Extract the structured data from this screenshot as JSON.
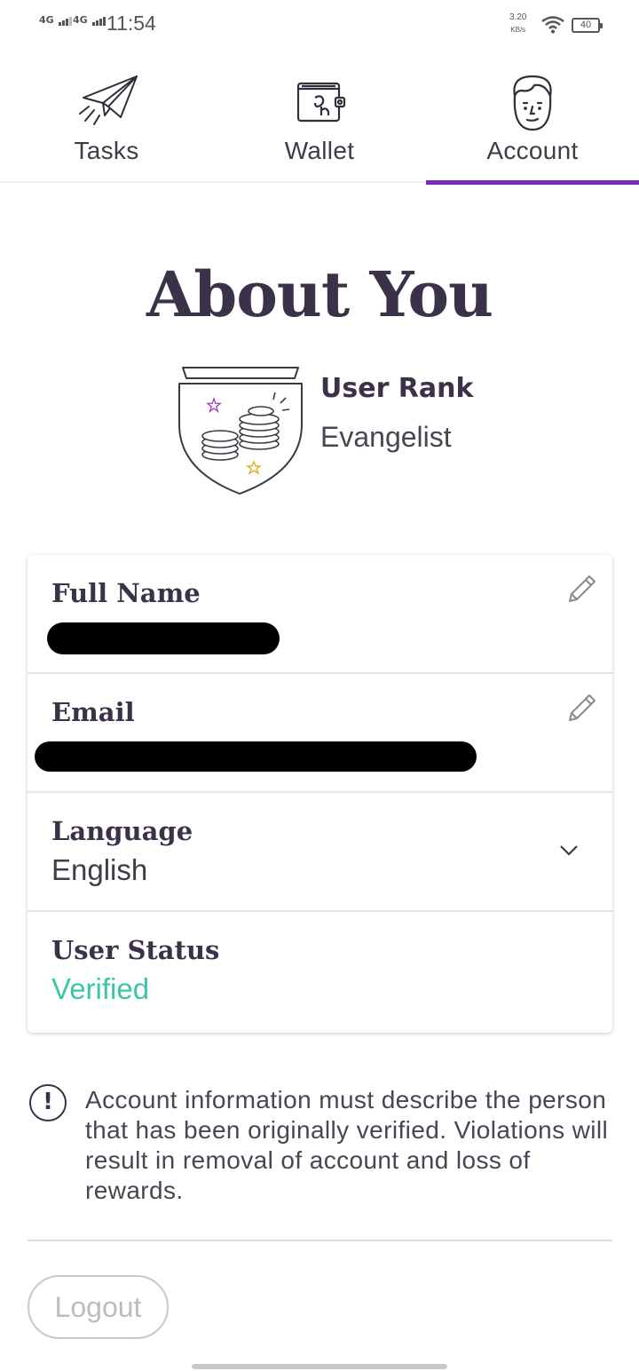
{
  "status_bar": {
    "signal1": "4G",
    "signal2": "4G",
    "time": "11:54",
    "net_speed": "3.20",
    "net_speed_unit": "KB/s",
    "battery": "40"
  },
  "tabs": [
    {
      "label": "Tasks",
      "icon": "paper-plane-icon",
      "active": false
    },
    {
      "label": "Wallet",
      "icon": "wallet-icon",
      "active": false
    },
    {
      "label": "Account",
      "icon": "face-icon",
      "active": true
    }
  ],
  "page": {
    "title": "About You",
    "rank_label": "User Rank",
    "rank_value": "Evangelist",
    "rank_icon": "coins-shield-icon"
  },
  "fields": {
    "full_name": {
      "label": "Full Name",
      "value_redacted": true
    },
    "email": {
      "label": "Email",
      "value_redacted": true
    },
    "language": {
      "label": "Language",
      "value": "English"
    },
    "user_status": {
      "label": "User Status",
      "value": "Verified"
    }
  },
  "notice": {
    "text": "Account information must describe the person that has been originally verified. Violations will result in removal of account and loss of rewards."
  },
  "logout_label": "Logout",
  "colors": {
    "accent": "#7b2bb8",
    "heading": "#3b3149",
    "verified": "#3cc6a9"
  }
}
